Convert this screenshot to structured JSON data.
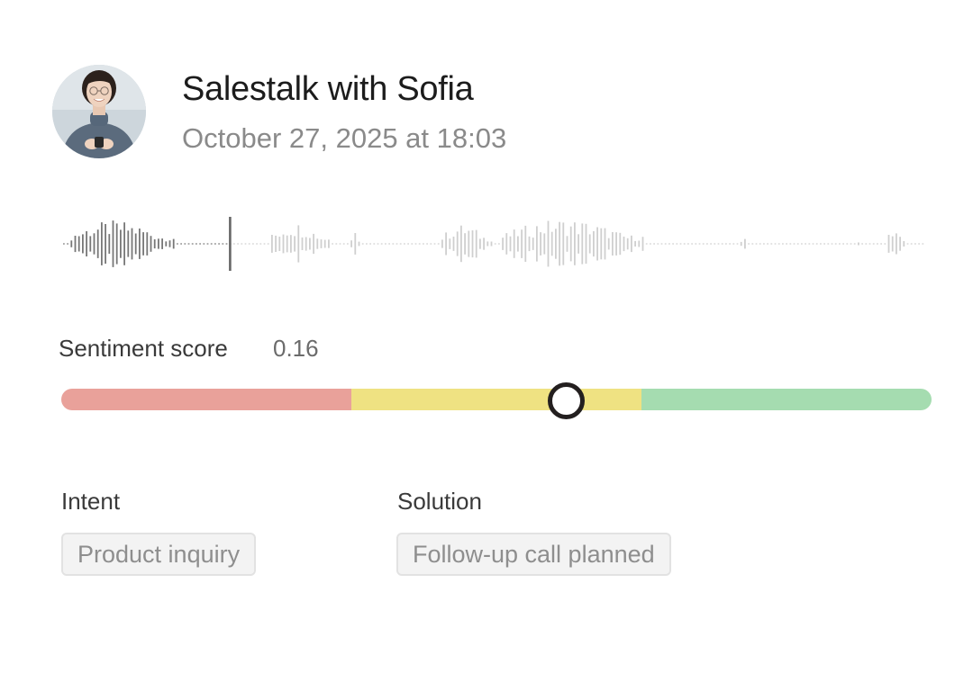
{
  "header": {
    "title": "Salestalk with Sofia",
    "datetime": "October 27, 2025 at 18:03",
    "avatar_icon": "person-photo-avatar"
  },
  "waveform": {
    "playback_progress": 0.195,
    "colors": {
      "played": "#777777",
      "unplayed": "#cfcfcf",
      "playhead": "#666666"
    }
  },
  "sentiment": {
    "label": "Sentiment score",
    "value": "0.16",
    "min": -1,
    "max": 1,
    "colors": {
      "negative": "#e9a19a",
      "neutral": "#efe282",
      "positive": "#a5dcb0",
      "knob_border": "#231f1f"
    }
  },
  "intent": {
    "label": "Intent",
    "value": "Product inquiry"
  },
  "solution": {
    "label": "Solution",
    "value": "Follow-up call planned"
  }
}
